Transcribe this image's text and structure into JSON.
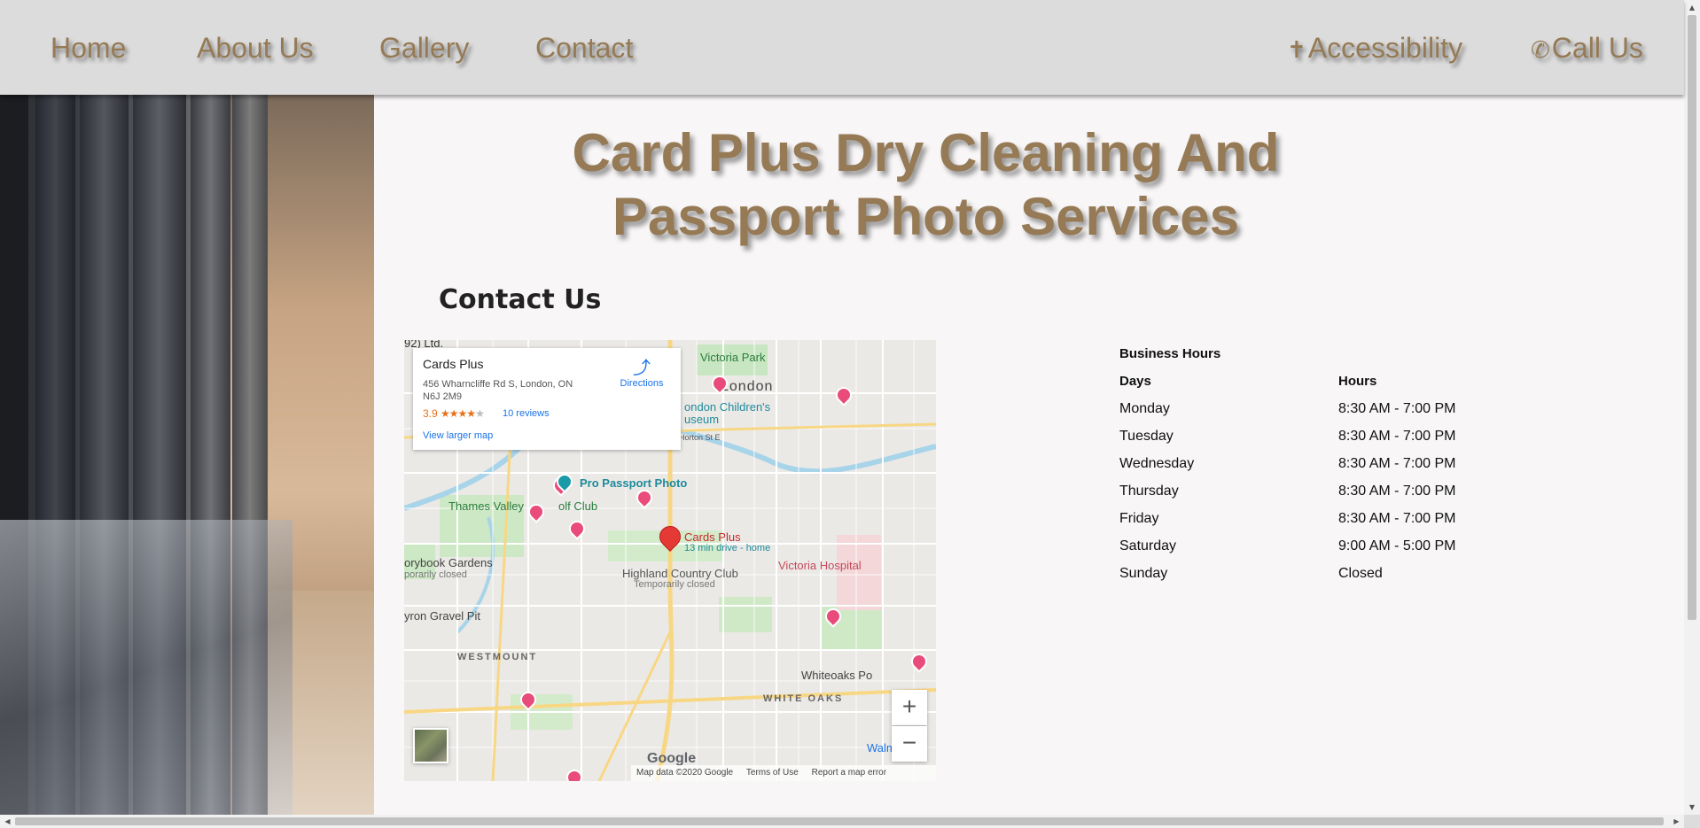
{
  "nav": {
    "home": "Home",
    "about": "About Us",
    "gallery": "Gallery",
    "contact": "Contact",
    "accessibility": "Accessibility",
    "call": "Call Us"
  },
  "page": {
    "title": "Card Plus Dry Cleaning And Passport Photo Services",
    "section_heading": "Contact Us"
  },
  "map": {
    "place_name": "Cards Plus",
    "address": "456 Wharncliffe Rd S, London, ON N6J 2M9",
    "rating": "3.9",
    "reviews": "10 reviews",
    "directions": "Directions",
    "larger_map": "View larger map",
    "marker_label": "Cards Plus",
    "marker_sub": "13 min drive - home",
    "labels": {
      "victoria_park": "Victoria Park",
      "london": "London",
      "childrens_museum": "ondon Children's",
      "museum": "useum",
      "pro_passport": "Pro Passport Photo",
      "thames_valley": "Thames Valley",
      "golf_club": "olf Club",
      "storybook": "orybook Gardens",
      "temporarily_closed_1": "porarily closed",
      "highland": "Highland Country Club",
      "temporarily_closed_2": "Temporarily closed",
      "victoria_hospital": "Victoria Hospital",
      "gravel_pit": "yron Gravel Pit",
      "westmount": "WESTMOUNT",
      "whiteoaks_po": "Whiteoaks Po",
      "white_oaks": "WHITE OAKS",
      "walmart": "Walm",
      "ltd": "92) Ltd.",
      "horton": "Horton St E"
    },
    "footer": {
      "data": "Map data ©2020 Google",
      "terms": "Terms of Use",
      "report": "Report a map error"
    },
    "zoom_in": "+",
    "zoom_out": "−",
    "logo": "Google"
  },
  "hours": {
    "caption": "Business Hours",
    "headers": [
      "Days",
      "Hours"
    ],
    "rows": [
      {
        "day": "Monday",
        "time": "8:30 AM - 7:00 PM"
      },
      {
        "day": "Tuesday",
        "time": "8:30 AM - 7:00 PM"
      },
      {
        "day": "Wednesday",
        "time": "8:30 AM - 7:00 PM"
      },
      {
        "day": "Thursday",
        "time": "8:30 AM - 7:00 PM"
      },
      {
        "day": "Friday",
        "time": "8:30 AM - 7:00 PM"
      },
      {
        "day": "Saturday",
        "time": "9:00 AM - 5:00 PM"
      },
      {
        "day": "Sunday",
        "time": "Closed"
      }
    ]
  },
  "colors": {
    "brand": "#957a55",
    "nav_bg": "#dcdcdc",
    "pin": "#e94b7b",
    "marker": "#e53935"
  }
}
